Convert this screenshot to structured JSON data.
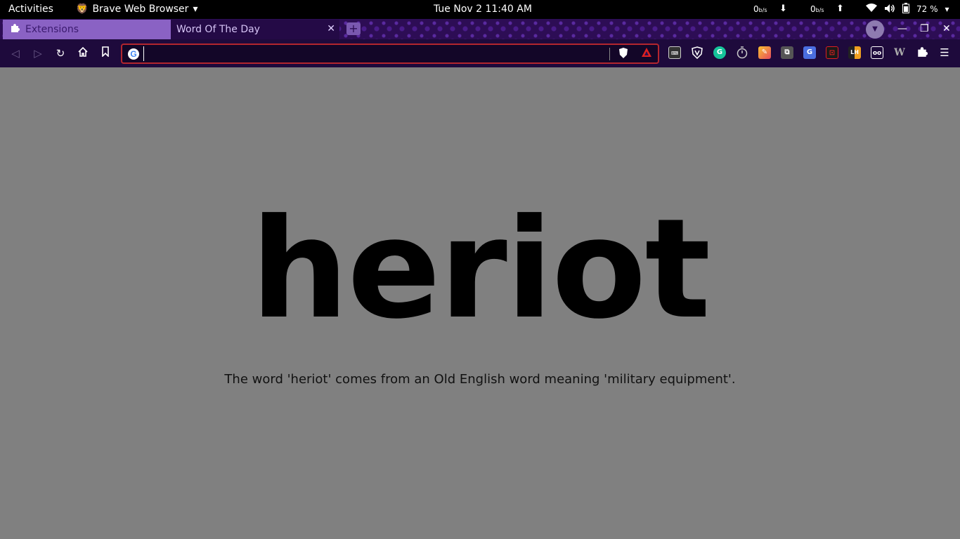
{
  "topbar": {
    "activities": "Activities",
    "app_name": "Brave Web Browser",
    "clock": "Tue Nov 2  11:40 AM",
    "net_down_value": "0",
    "net_down_unit": "b/s",
    "net_up_value": "0",
    "net_up_unit": "b/s",
    "battery": "72 %"
  },
  "tabs": [
    {
      "label": "Extensions"
    },
    {
      "label": "Word Of The Day"
    }
  ],
  "toolbar": {
    "address_value": "",
    "extensions": [
      "keyboard-shortcuts",
      "shield-ext",
      "grammarly",
      "timer",
      "color-picker",
      "copy-ext",
      "google-translate",
      "pdf-ext",
      "lh-ext",
      "reader-ext",
      "w-ext",
      "extensions-puzzle"
    ]
  },
  "page": {
    "word": "heriot",
    "fact": "The word 'heriot' comes from an Old English word meaning 'military equipment'."
  },
  "colors": {
    "page_bg": "#808080",
    "tab_active": "#8a62c4",
    "omnibox_border": "#b3262e"
  }
}
